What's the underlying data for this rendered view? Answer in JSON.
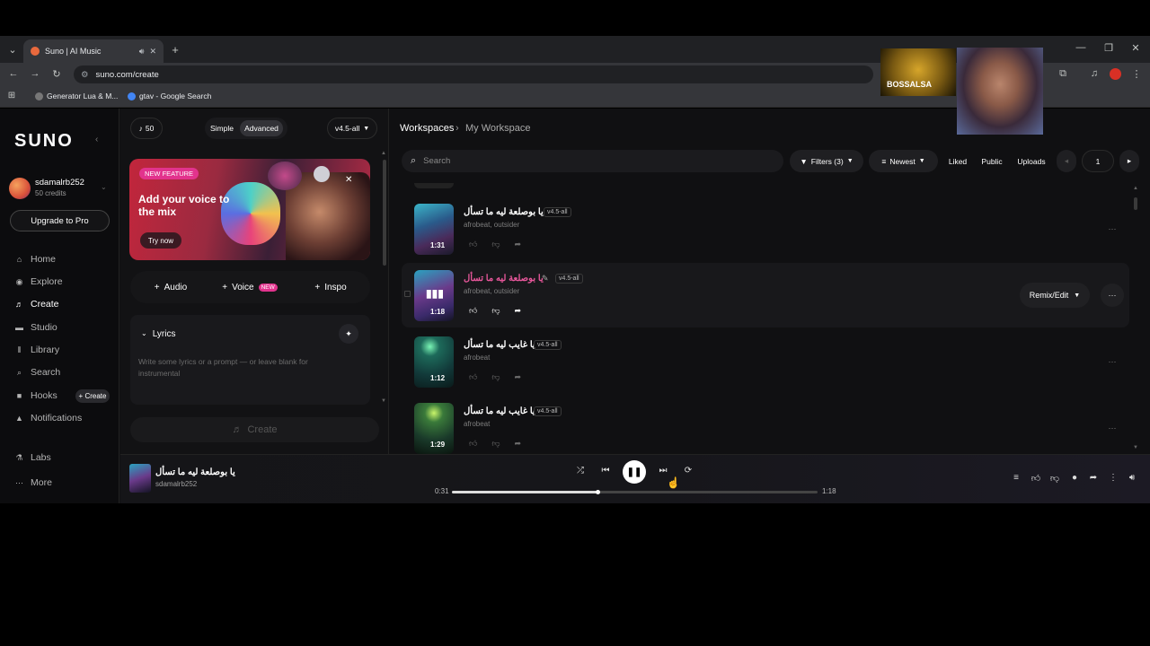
{
  "browser": {
    "tab_title": "Suno | AI Music",
    "url": "suno.com/create",
    "bookmarks": [
      "Generator Lua & M...",
      "gtav - Google Search"
    ]
  },
  "overlay": {
    "channel_logo_text": "BOSSALSA"
  },
  "sidebar": {
    "logo": "SUNO",
    "username": "sdamalrb252",
    "credits": "50 credits",
    "upgrade_label": "Upgrade to Pro",
    "items": [
      {
        "label": "Home",
        "icon": "home-icon"
      },
      {
        "label": "Explore",
        "icon": "compass-icon"
      },
      {
        "label": "Create",
        "icon": "music-note-icon"
      },
      {
        "label": "Studio",
        "icon": "studio-icon"
      },
      {
        "label": "Library",
        "icon": "library-icon"
      },
      {
        "label": "Search",
        "icon": "search-icon"
      },
      {
        "label": "Hooks",
        "icon": "hooks-icon"
      },
      {
        "label": "Notifications",
        "icon": "bell-icon"
      },
      {
        "label": "Labs",
        "icon": "flask-icon"
      },
      {
        "label": "More",
        "icon": "more-icon"
      }
    ],
    "hooks_create": "+ Create"
  },
  "create_panel": {
    "credits_count": "50",
    "mode_simple": "Simple",
    "mode_advanced": "Advanced",
    "model": "v4.5-all",
    "banner": {
      "badge": "NEW FEATURE",
      "title": "Add your voice to the mix",
      "cta": "Try now"
    },
    "tools": [
      "Audio",
      "Voice",
      "Inspo"
    ],
    "voice_badge": "NEW",
    "lyrics_label": "Lyrics",
    "lyrics_placeholder": "Write some lyrics or a prompt — or leave blank for instrumental",
    "create_label": "Create"
  },
  "workspace": {
    "breadcrumb_root": "Workspaces",
    "breadcrumb_current": "My Workspace",
    "search_placeholder": "Search",
    "filters_label": "Filters (3)",
    "sort_label": "Newest",
    "liked_label": "Liked",
    "public_label": "Public",
    "uploads_label": "Uploads",
    "page_number": "1",
    "remix_label": "Remix/Edit",
    "songs": [
      {
        "title": "يا بوصلعة ليه ما تسأل",
        "version": "v4.5-all",
        "tags": "afrobeat, outsider",
        "duration": "1:31"
      },
      {
        "title": "يا بوصلعة ليه ما تسأل",
        "version": "v4.5-all",
        "tags": "afrobeat, outsider",
        "duration": "1:18"
      },
      {
        "title": "يا غايب ليه ما تسأل",
        "version": "v4.5-all",
        "tags": "afrobeat",
        "duration": "1:12"
      },
      {
        "title": "يا غايب ليه ما تسأل",
        "version": "v4.5-all",
        "tags": "afrobeat",
        "duration": "1:29"
      }
    ]
  },
  "player": {
    "title": "يا بوصلعة ليه ما تسأل",
    "artist": "sdamalrb252",
    "current_time": "0:31",
    "total_time": "1:18",
    "progress": 0.397
  },
  "colors": {
    "accent_pink": "#e2338d",
    "background": "#101012"
  }
}
